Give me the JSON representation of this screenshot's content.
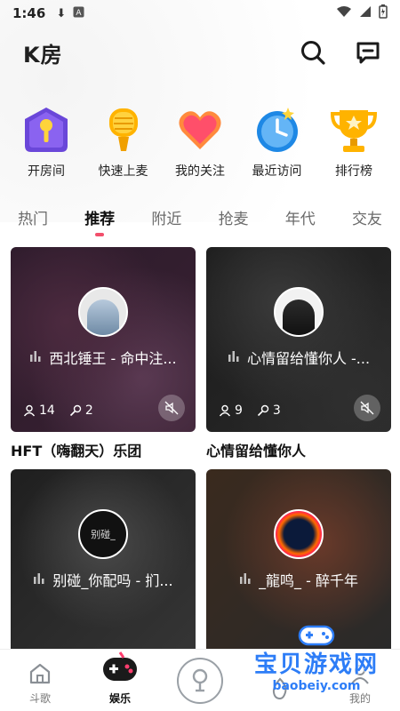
{
  "status_bar": {
    "time": "1:46"
  },
  "header": {
    "title": "K房"
  },
  "quick_actions": [
    {
      "label": "开房间",
      "icon": "house-mic-icon"
    },
    {
      "label": "快速上麦",
      "icon": "microphone-icon"
    },
    {
      "label": "我的关注",
      "icon": "heart-icon"
    },
    {
      "label": "最近访问",
      "icon": "clock-icon"
    },
    {
      "label": "排行榜",
      "icon": "trophy-icon"
    }
  ],
  "tabs": [
    {
      "label": "热门",
      "active": false
    },
    {
      "label": "推荐",
      "active": true
    },
    {
      "label": "附近",
      "active": false
    },
    {
      "label": "抢麦",
      "active": false
    },
    {
      "label": "年代",
      "active": false
    },
    {
      "label": "交友",
      "active": false
    }
  ],
  "rooms": [
    {
      "song": "西北锤王 - 命中注...",
      "listeners": "14",
      "singers": "2",
      "title": "HFT（嗨翻天）乐团"
    },
    {
      "song": "心情留给懂你人 -...",
      "listeners": "9",
      "singers": "3",
      "title": "心情留给懂你人"
    },
    {
      "song": "别碰_你配吗 - 扪...",
      "avatar_text": "别碰_",
      "title": ""
    },
    {
      "song": "_龍鸣_ - 醉千年",
      "title": ""
    }
  ],
  "bottom_nav": [
    {
      "label": "斗歌"
    },
    {
      "label": "娱乐"
    },
    {
      "label": ""
    },
    {
      "label": ""
    },
    {
      "label": "我的"
    }
  ],
  "watermark": {
    "cn": "宝贝游戏网",
    "en": "baobeiy.com"
  }
}
